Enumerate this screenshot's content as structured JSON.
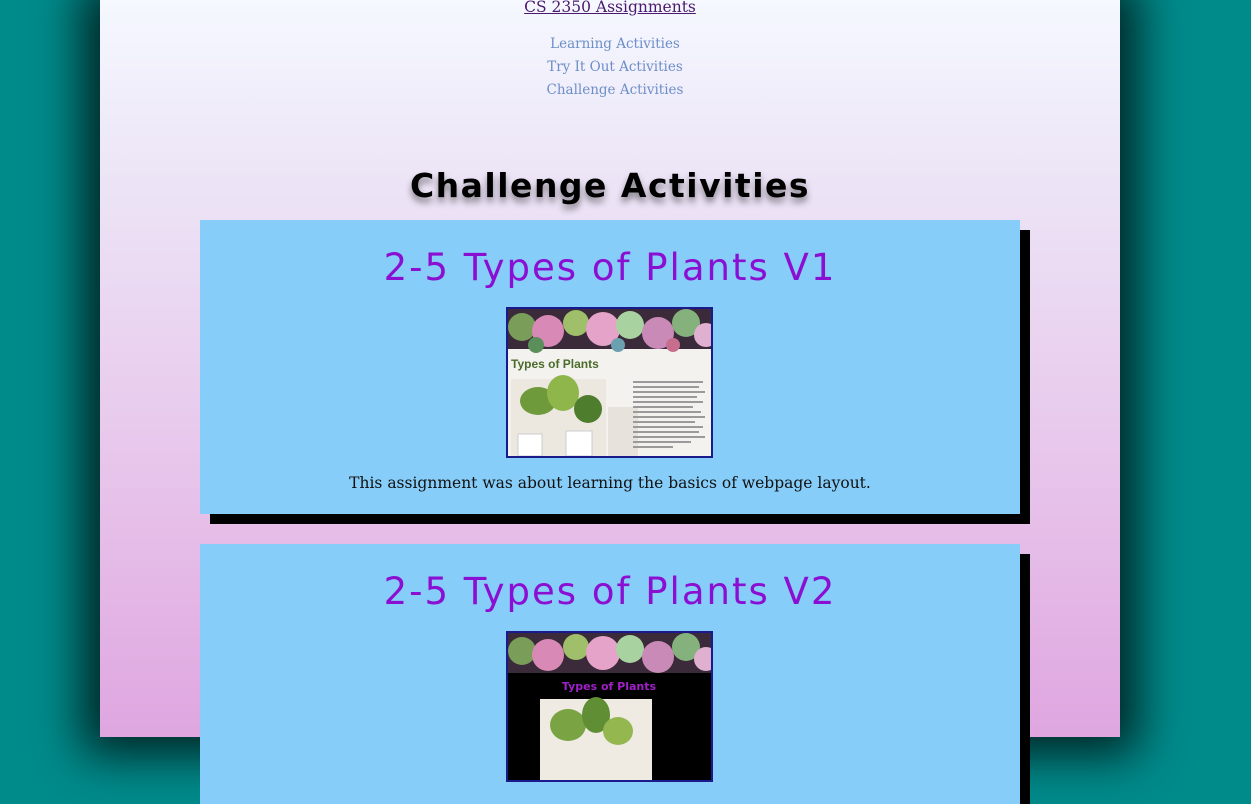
{
  "header": {
    "site_link": "CS 2350 Assignments",
    "nav": [
      "Learning Activities",
      "Try It Out Activities",
      "Challenge Activities"
    ]
  },
  "page_title": "Challenge Activities",
  "cards": [
    {
      "title": "2-5 Types of Plants V1",
      "thumb_heading": "Types of Plants",
      "description": "This assignment was about learning the basics of webpage layout."
    },
    {
      "title": "2-5 Types of Plants V2",
      "thumb_heading": "Types of Plants"
    }
  ],
  "colors": {
    "background": "#008b8b",
    "card": "#87cdf9",
    "card_title": "#8b0fd3",
    "nav_link": "#6d8ec8"
  }
}
